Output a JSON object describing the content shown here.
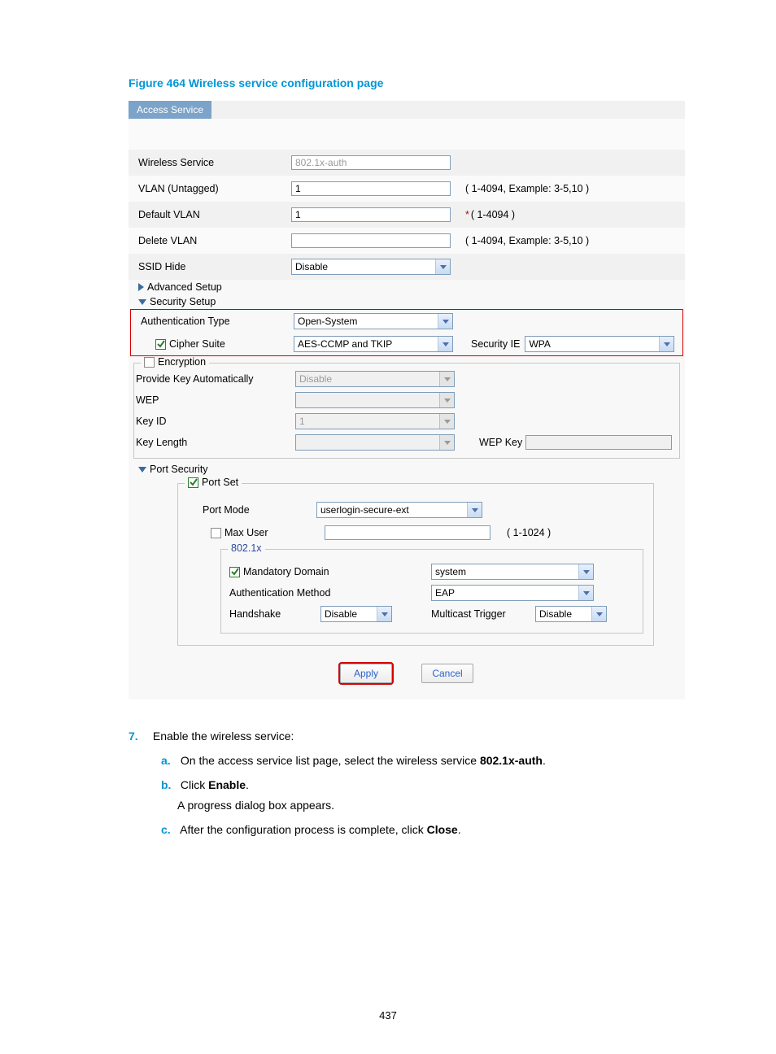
{
  "figure_title": "Figure 464 Wireless service configuration page",
  "tab": "Access Service",
  "rows": {
    "wireless_service": {
      "label": "Wireless Service",
      "value": "802.1x-auth"
    },
    "vlan_untagged": {
      "label": "VLAN (Untagged)",
      "value": "1",
      "hint": "( 1-4094, Example: 3-5,10 )"
    },
    "default_vlan": {
      "label": "Default VLAN",
      "value": "1",
      "hint": "( 1-4094 )"
    },
    "delete_vlan": {
      "label": "Delete VLAN",
      "value": "",
      "hint": "( 1-4094, Example: 3-5,10 )"
    },
    "ssid_hide": {
      "label": "SSID Hide",
      "value": "Disable"
    }
  },
  "toggles": {
    "advanced": "Advanced Setup",
    "security": "Security Setup",
    "port_security": "Port Security"
  },
  "security": {
    "auth_type": {
      "label": "Authentication Type",
      "value": "Open-System"
    },
    "cipher_suite": {
      "label": "Cipher Suite",
      "value": "AES-CCMP and TKIP"
    },
    "security_ie": {
      "label": "Security IE",
      "value": "WPA"
    }
  },
  "encryption": {
    "legend": "Encryption",
    "provide_key": {
      "label": "Provide Key Automatically",
      "value": "Disable"
    },
    "wep": {
      "label": "WEP",
      "value": ""
    },
    "key_id": {
      "label": "Key ID",
      "value": "1"
    },
    "key_length": {
      "label": "Key Length",
      "value": ""
    },
    "wep_key_label": "WEP Key",
    "wep_key_value": ""
  },
  "port": {
    "legend": "Port Set",
    "port_mode": {
      "label": "Port Mode",
      "value": "userlogin-secure-ext"
    },
    "max_user": {
      "label": "Max User",
      "value": "",
      "hint": "( 1-1024 )"
    }
  },
  "dot1x": {
    "legend": "802.1x",
    "mandatory_domain": {
      "label": "Mandatory Domain",
      "value": "system"
    },
    "auth_method": {
      "label": "Authentication Method",
      "value": "EAP"
    },
    "handshake": {
      "label": "Handshake",
      "value": "Disable"
    },
    "multicast": {
      "label": "Multicast Trigger",
      "value": "Disable"
    }
  },
  "buttons": {
    "apply": "Apply",
    "cancel": "Cancel"
  },
  "instructions": {
    "step_num": "7.",
    "step_text": "Enable the wireless service:",
    "a_letter": "a.",
    "a_pre": "On the access service list page, select the wireless service ",
    "a_bold": "802.1x-auth",
    "a_post": ".",
    "b_letter": "b.",
    "b_pre": "Click ",
    "b_bold": "Enable",
    "b_post": ".",
    "b_extra": "A progress dialog box appears.",
    "c_letter": "c.",
    "c_pre": "After the configuration process is complete, click ",
    "c_bold": "Close",
    "c_post": "."
  },
  "page_number": "437"
}
